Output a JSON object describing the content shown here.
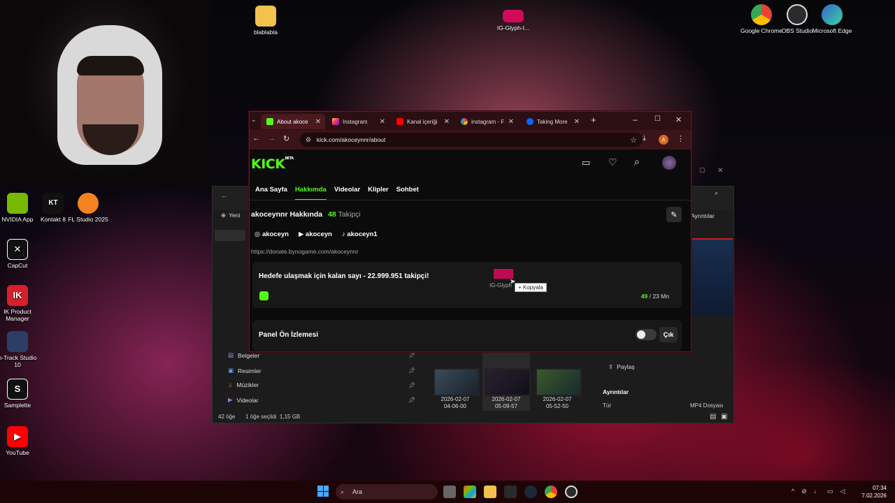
{
  "desktop": {
    "top_icons": [
      {
        "label": "blablabla",
        "icon": "folder-icon"
      },
      {
        "label": "IG-Glyph-I...",
        "icon": "instagram-glyph-icon"
      },
      {
        "label": "Google Chrome",
        "icon": "chrome-icon"
      },
      {
        "label": "OBS Studio",
        "icon": "obs-icon"
      },
      {
        "label": "Microsoft Edge",
        "icon": "edge-icon"
      }
    ],
    "left_icons": [
      {
        "label": "NVIDIA App",
        "icon": "nvidia-icon"
      },
      {
        "label": "Kontakt 8",
        "icon": "kontakt-icon"
      },
      {
        "label": "FL Studio 2025",
        "icon": "flstudio-icon"
      },
      {
        "label": "CapCut",
        "icon": "capcut-icon"
      },
      {
        "label": "IK Product Manager",
        "icon": "ik-icon"
      },
      {
        "label": "n-Track Studio 10",
        "icon": "ntrack-icon"
      },
      {
        "label": "Samplette",
        "icon": "samplette-icon"
      },
      {
        "label": "YouTube",
        "icon": "youtube-icon"
      }
    ]
  },
  "browser": {
    "tabs": [
      {
        "title": "About akoce",
        "icon": "kick-icon",
        "active": true
      },
      {
        "title": "Instagram",
        "icon": "instagram-icon",
        "active": false
      },
      {
        "title": "Kanal içeriği",
        "icon": "youtube-icon",
        "active": false
      },
      {
        "title": "instagram - F",
        "icon": "google-icon",
        "active": false
      },
      {
        "title": "Taking More",
        "icon": "meta-icon",
        "active": false
      }
    ],
    "url": "kick.com/akoceynnr/about",
    "profile_initial": "A"
  },
  "kick": {
    "logo": "KICK",
    "logo_badge": "BETA",
    "nav": [
      "Ana Sayfa",
      "Hakkımda",
      "Videolar",
      "Klipler",
      "Sohbet"
    ],
    "selected_nav": "Hakkımda",
    "about_title": "akoceynnr Hakkında",
    "follower_count": "48",
    "follower_label": "Takipçi",
    "socials": [
      {
        "platform": "instagram",
        "handle": "akoceyn"
      },
      {
        "platform": "youtube",
        "handle": "akoceyn"
      },
      {
        "platform": "tiktok",
        "handle": "akoceyn1"
      }
    ],
    "donate_link": "https://donate.bynogame.com/akoceynnr",
    "goal": {
      "text": "Hedefe ulaşmak için kalan sayı - 22.999.951 takipçi!",
      "current": "49",
      "target": "/ 23 Mn",
      "progress": 2.1e-06
    },
    "panel_preview": {
      "label": "Panel Ön İzlemesi",
      "toggle_on": false,
      "exit_label": "Çık"
    },
    "drag": {
      "file_label": "IG-Glyph",
      "tooltip": "+ Kopyala"
    }
  },
  "explorer": {
    "new_label": "Yeni",
    "share_label": "Paylaş",
    "details_btn": "Ayrıntılar",
    "sidebar": [
      {
        "label": "Belgeler",
        "icon": "documents-icon"
      },
      {
        "label": "Resimler",
        "icon": "pictures-icon"
      },
      {
        "label": "Müzikler",
        "icon": "music-icon"
      },
      {
        "label": "Videolar",
        "icon": "videos-icon"
      }
    ],
    "thumbs": [
      {
        "date": "2026-02-07",
        "time": "04-06-00"
      },
      {
        "date": "2026-02-07",
        "time": "05-09-57"
      },
      {
        "date": "2026-02-07",
        "time": "05-52-50"
      }
    ],
    "details_title": "Ayrıntılar",
    "type_label": "Tür",
    "type_value": "MP4 Dosyası",
    "status_items": "42 öğe",
    "status_selected": "1 öğe seçildi  1,15 GB"
  },
  "taskbar": {
    "search_placeholder": "Ara",
    "time": "07:34",
    "date": "7.02.2026"
  },
  "colors": {
    "kick_green": "#53fc18",
    "browser_frame": "#6b1620"
  }
}
